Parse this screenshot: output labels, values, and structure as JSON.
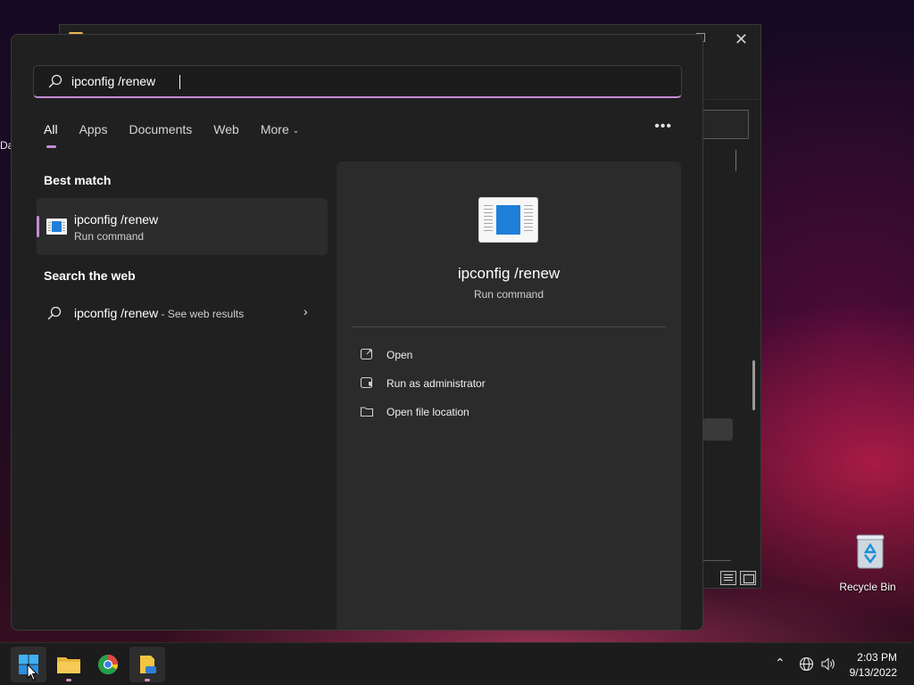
{
  "desktop": {
    "stray_label": "Da"
  },
  "search": {
    "query": "ipconfig /renew",
    "tabs": [
      {
        "label": "All",
        "active": true
      },
      {
        "label": "Apps"
      },
      {
        "label": "Documents"
      },
      {
        "label": "Web"
      },
      {
        "label": "More"
      }
    ],
    "best_match_heading": "Best match",
    "best_match": {
      "title": "ipconfig /renew",
      "subtitle": "Run command"
    },
    "web_heading": "Search the web",
    "web_result": {
      "query": "ipconfig /renew",
      "suffix": " - See web results"
    },
    "preview": {
      "title": "ipconfig /renew",
      "subtitle": "Run command",
      "actions": [
        {
          "label": "Open",
          "icon": "open-external-icon"
        },
        {
          "label": "Run as administrator",
          "icon": "admin-shield-icon"
        },
        {
          "label": "Open file location",
          "icon": "folder-icon"
        }
      ]
    },
    "accent_color": "#c58bd6"
  },
  "recycle_bin": {
    "label": "Recycle Bin"
  },
  "taskbar": {
    "apps": [
      {
        "name": "start-button",
        "icon": "windows-logo-icon"
      },
      {
        "name": "file-explorer",
        "icon": "folder-icon"
      },
      {
        "name": "chrome",
        "icon": "chrome-icon"
      },
      {
        "name": "app",
        "icon": "file-icon"
      }
    ],
    "clock": {
      "time": "2:03 PM",
      "date": "9/13/2022"
    }
  }
}
